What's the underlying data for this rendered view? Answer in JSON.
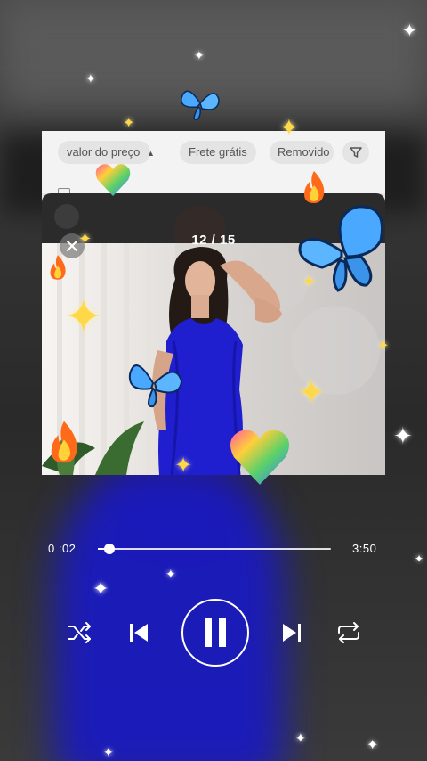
{
  "filters": {
    "price_chip": "valor do preço",
    "free_shipping_chip": "Frete grátis",
    "removed_chip": "Removido",
    "filter_icon": "filter-icon"
  },
  "viewer": {
    "counter": "12 / 15",
    "close_icon": "close-icon"
  },
  "player": {
    "current_time": "0 :02",
    "duration": "3:50",
    "progress_percent": 5,
    "icons": [
      "shuffle-icon",
      "previous-icon",
      "pause-icon",
      "next-icon",
      "repeat-icon"
    ]
  },
  "colors": {
    "dress_blue": "#1f1fd0",
    "sparkle_gold": "#ffd84a",
    "butterfly_blue": "#4aa8ff"
  }
}
